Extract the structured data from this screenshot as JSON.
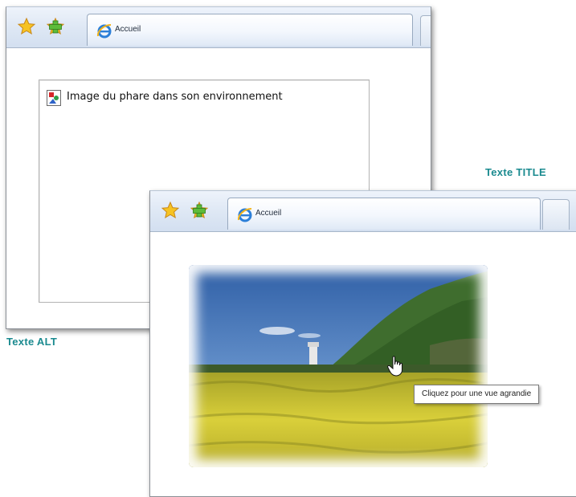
{
  "tab": {
    "label": "Accueil"
  },
  "window_alt": {
    "alt_text": "Image du phare dans son environnement"
  },
  "window_title": {
    "tooltip": "Cliquez pour une vue agrandie"
  },
  "captions": {
    "alt": "Texte ALT",
    "title": "Texte TITLE"
  },
  "icons": {
    "favorites": "star-icon",
    "add_favorites": "add-star-icon",
    "tab": "ie-icon",
    "broken_image": "broken-image-icon",
    "cursor": "hand-cursor-icon"
  },
  "colors": {
    "caption": "#1a8a8f",
    "tabbar": "#dde7f4"
  }
}
